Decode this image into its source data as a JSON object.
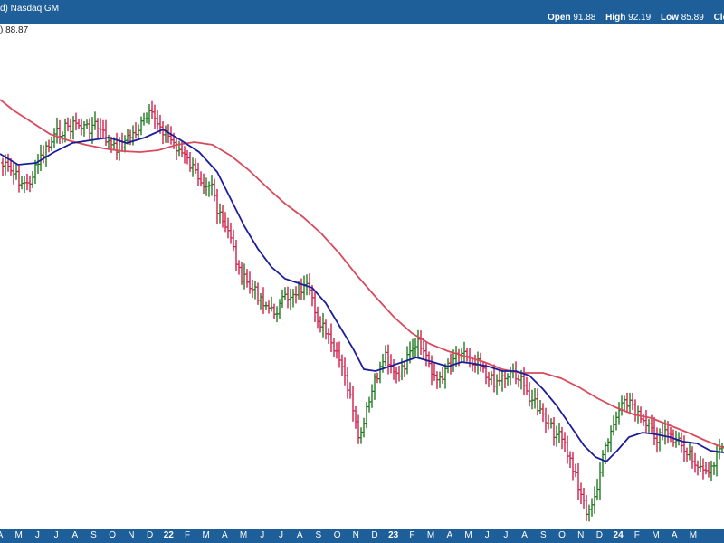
{
  "header": {
    "exchange_text": "d)  Nasdaq GM",
    "ohlc": [
      {
        "label": "Open",
        "value": "91.88"
      },
      {
        "label": "High",
        "value": "92.19"
      },
      {
        "label": "Low",
        "value": "85.89"
      },
      {
        "label": "Clo",
        "value": ""
      }
    ]
  },
  "legend_text": ") 88.87",
  "colors": {
    "header_bg": "#1f5f99",
    "up_bar": "#1e7a1e",
    "down_bar": "#d0204a",
    "ma_short": "#1c1c9c",
    "ma_long": "#d84a5c"
  },
  "chart_data": {
    "type": "line",
    "x": [
      "2021-05",
      "2021-06",
      "2021-07",
      "2021-08",
      "2021-09",
      "2021-10",
      "2021-11",
      "2021-12",
      "2022-01",
      "2022-02",
      "2022-03",
      "2022-04",
      "2022-05",
      "2022-06",
      "2022-07",
      "2022-08",
      "2022-09",
      "2022-10",
      "2022-11",
      "2022-12",
      "2023-01",
      "2023-02",
      "2023-03",
      "2023-04",
      "2023-05",
      "2023-06",
      "2023-07",
      "2023-08",
      "2023-09",
      "2023-10",
      "2023-11",
      "2023-12",
      "2024-01",
      "2024-02",
      "2024-03",
      "2024-04",
      "2024-05",
      "2024-06"
    ],
    "x_tick_labels": [
      "A",
      "M",
      "J",
      "J",
      "A",
      "S",
      "O",
      "N",
      "D",
      "22",
      "F",
      "M",
      "A",
      "M",
      "J",
      "J",
      "A",
      "S",
      "O",
      "N",
      "D",
      "23",
      "F",
      "M",
      "A",
      "M",
      "J",
      "J",
      "A",
      "S",
      "O",
      "N",
      "D",
      "24",
      "F",
      "M",
      "A",
      "M"
    ],
    "series": [
      {
        "values": [
          0.78,
          0.72,
          0.7,
          0.78,
          0.88,
          0.93,
          0.92,
          0.97,
          0.8,
          0.6,
          0.4,
          0.3,
          0.38,
          0.2,
          0.08,
          0.22,
          0.32,
          0.37,
          0.32,
          0.34,
          0.3,
          0.25,
          0.1,
          0.01,
          0.03,
          0.25,
          0.38,
          0.36,
          0.28,
          0.1,
          0.12
        ]
      },
      {
        "values": []
      },
      {
        "values": []
      }
    ],
    "grid": false,
    "legend": "top-left"
  }
}
